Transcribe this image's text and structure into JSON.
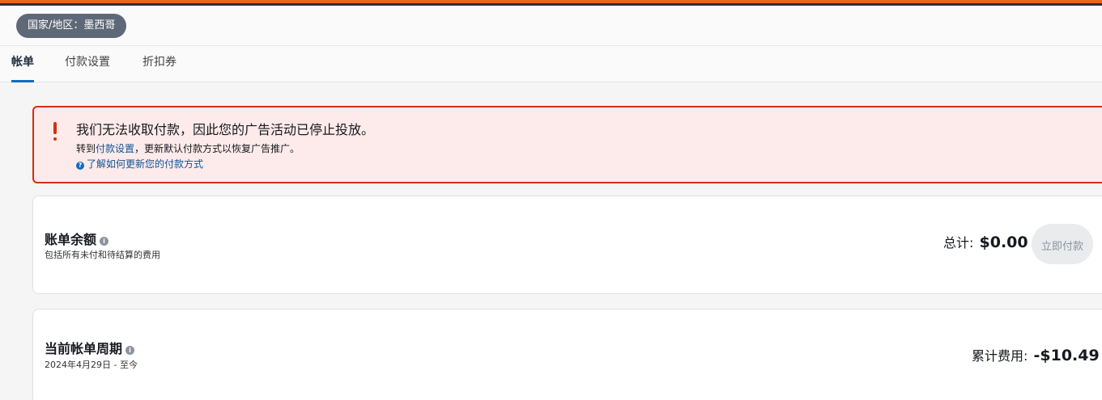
{
  "header": {
    "region_label": "国家/地区：墨西哥"
  },
  "tabs": [
    {
      "label": "帐单",
      "active": true
    },
    {
      "label": "付款设置",
      "active": false
    },
    {
      "label": "折扣券",
      "active": false
    }
  ],
  "alert": {
    "title": "我们无法收取付款，因此您的广告活动已停止投放。",
    "body_prefix": "转到",
    "body_link": "付款设置",
    "body_suffix": "，更新默认付款方式以恢复广告推广。",
    "help_link": "了解如何更新您的付款方式",
    "color": "#d13212"
  },
  "balance": {
    "title": "账单余额",
    "subtitle": "包括所有未付和待结算的费用",
    "total_label": "总计:",
    "total_value": "$0.00",
    "pay_button": "立即付款"
  },
  "cycle": {
    "title": "当前帐单周期",
    "subtitle": "2024年4月29日 - 至今",
    "cost_label": "累计费用:",
    "cost_value": "-$10.49"
  }
}
